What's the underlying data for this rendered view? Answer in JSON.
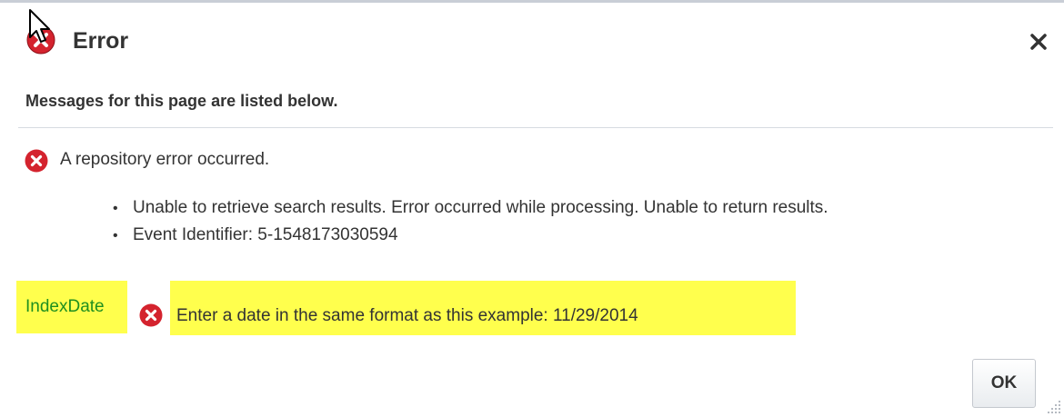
{
  "dialog": {
    "title": "Error",
    "close_icon": "close-icon",
    "title_icon": "error-icon"
  },
  "messages": {
    "header": "Messages for this page are listed below.",
    "main_error": "A repository error occurred.",
    "details": [
      "Unable to retrieve search results. Error occurred while processing. Unable to return results.",
      "Event Identifier: 5-1548173030594"
    ]
  },
  "field_error": {
    "field_label": "IndexDate",
    "message": "Enter a date in the same format as this example: 11/29/2014"
  },
  "footer": {
    "ok_label": "OK"
  },
  "colors": {
    "error_red": "#d4232e",
    "highlight": "#ffff4d",
    "field_label": "#1f8f1f",
    "text": "#333333"
  }
}
